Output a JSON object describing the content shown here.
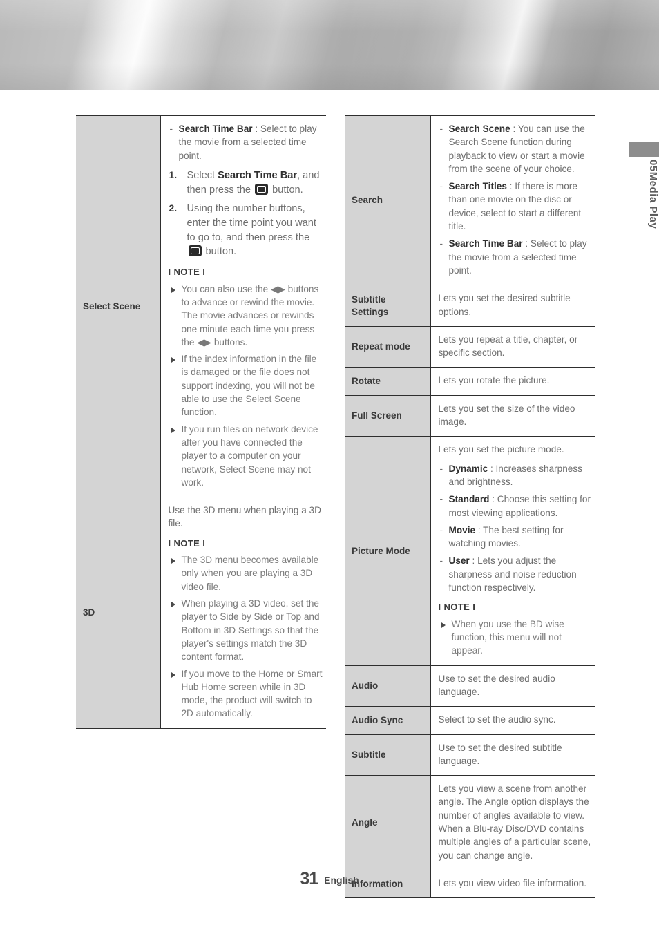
{
  "document": {
    "chapter_number": "05",
    "chapter_title": "Media Play",
    "page_number": "31",
    "language": "English"
  },
  "icons": {
    "enter_button": "enter-button-icon",
    "left_right_arrows": "◀▶"
  },
  "left_column": {
    "rows": [
      {
        "label": "Select Scene",
        "dash_items": [
          {
            "term": "Search Time Bar",
            "sep": " : ",
            "text": "Select to play the movie from a selected time point."
          }
        ],
        "steps": [
          {
            "pre": "Select ",
            "bold": "Search Time Bar",
            "post": ", and then press the ",
            "post2": " button."
          },
          {
            "pre": "Using the number buttons, enter the time point you want to go to, and then press the ",
            "post2": " button."
          }
        ],
        "note_label": "I NOTE I",
        "notes": [
          "You can also use the ◀▶ buttons to advance or rewind the movie. The movie advances or rewinds one minute each time you press the ◀▶ buttons.",
          "If the index information in the file is damaged or the file does not support indexing, you will not be able to use the Select Scene function.",
          "If you run files on network device after you have connected the player to a computer on your network, Select Scene may not work."
        ]
      },
      {
        "label": "3D",
        "intro": "Use the 3D menu when playing a 3D file.",
        "note_label": "I NOTE I",
        "notes": [
          "The 3D menu becomes available only when you are playing a 3D video file.",
          "When playing a 3D video, set the player to Side by Side or Top and Bottom in 3D Settings so that the player's settings match the 3D content format.",
          "If you move to the Home or Smart Hub Home screen while in 3D mode, the product will switch to 2D automatically."
        ]
      }
    ]
  },
  "right_column": {
    "rows": [
      {
        "label": "Search",
        "dash_items": [
          {
            "term": "Search Scene",
            "sep": " : ",
            "text": "You can use the Search Scene function during playback to view or start a movie from the scene of your choice."
          },
          {
            "term": "Search Titles",
            "sep": " : ",
            "text": "If there is more than one movie on the disc or device, select to start a different title."
          },
          {
            "term": "Search Time Bar",
            "sep": " : ",
            "text": "Select to play the movie from a selected time point."
          }
        ]
      },
      {
        "label": "Subtitle Settings",
        "text": "Lets you set the desired subtitle options."
      },
      {
        "label": "Repeat mode",
        "text": "Lets you repeat a title, chapter, or specific section."
      },
      {
        "label": "Rotate",
        "text": "Lets you rotate the picture."
      },
      {
        "label": "Full Screen",
        "text": "Lets you set the size of the video image."
      },
      {
        "label": "Picture Mode",
        "intro": "Lets you set the picture mode.",
        "dash_items": [
          {
            "term": "Dynamic",
            "sep": " : ",
            "text": "Increases sharpness and brightness."
          },
          {
            "term": "Standard",
            "sep": " : ",
            "text": "Choose this setting for most viewing applications."
          },
          {
            "term": "Movie",
            "sep": " : ",
            "text": "The best setting for watching movies."
          },
          {
            "term": "User",
            "sep": " : ",
            "text": "Lets you adjust the sharpness and noise reduction function respectively."
          }
        ],
        "note_label": "I NOTE I",
        "notes": [
          "When you use the BD wise function, this menu will not appear."
        ]
      },
      {
        "label": "Audio",
        "text": "Use to set the desired audio language."
      },
      {
        "label": "Audio Sync",
        "text": "Select to set the audio sync."
      },
      {
        "label": "Subtitle",
        "text": "Use to set the desired subtitle language."
      },
      {
        "label": "Angle",
        "text": "Lets you view a scene from another angle. The Angle option displays the number of angles available to view. When a Blu-ray Disc/DVD contains multiple angles of a particular scene, you can change angle."
      },
      {
        "label": "Information",
        "text": "Lets you view video file information."
      }
    ]
  },
  "colors": {
    "label_cell_bg": "#d4d4d4",
    "border": "#2e2e2e",
    "body_text": "#6e6e6e",
    "term_text": "#2f2f2f",
    "side_tab_bar": "#8d8d8d"
  }
}
